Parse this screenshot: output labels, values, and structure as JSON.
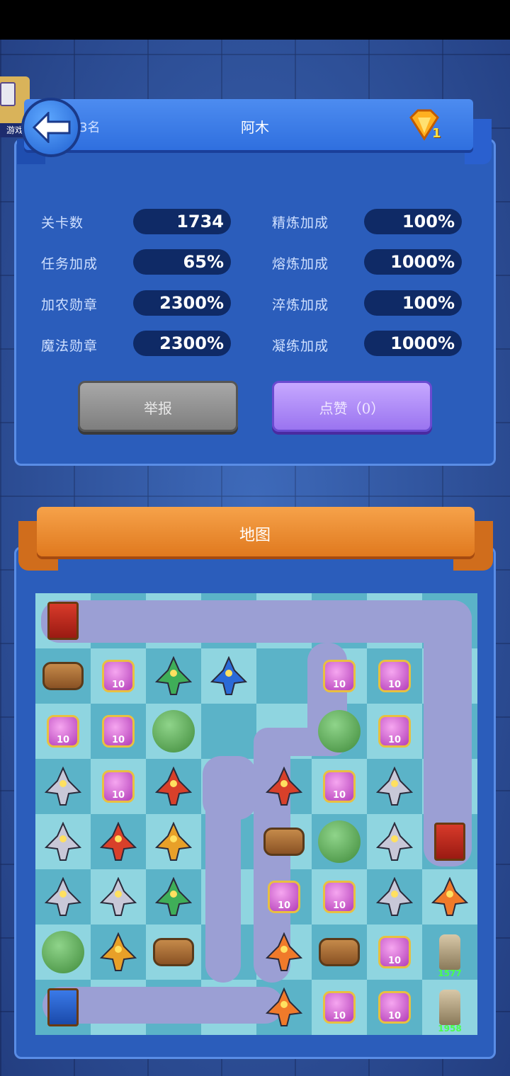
{
  "side_tab": {
    "label": "游戏"
  },
  "header": {
    "rank": "3名",
    "player_name": "阿木",
    "gem_count": "1"
  },
  "stats": {
    "left": [
      {
        "label": "关卡数",
        "value": "1734"
      },
      {
        "label": "任务加成",
        "value": "65%"
      },
      {
        "label": "加农勋章",
        "value": "2300%"
      },
      {
        "label": "魔法勋章",
        "value": "2300%"
      }
    ],
    "right": [
      {
        "label": "精炼加成",
        "value": "100%"
      },
      {
        "label": "熔炼加成",
        "value": "1000%"
      },
      {
        "label": "淬炼加成",
        "value": "100%"
      },
      {
        "label": "凝练加成",
        "value": "1000%"
      }
    ]
  },
  "buttons": {
    "report": "举报",
    "like": "点赞（0）"
  },
  "map": {
    "title": "地图",
    "tower_values": [
      "1577",
      "1958"
    ],
    "pot_level": "10"
  },
  "colors": {
    "gem": "#ffb020",
    "panel": "#2b5dbb",
    "map_ribbon": "#e0791e"
  }
}
